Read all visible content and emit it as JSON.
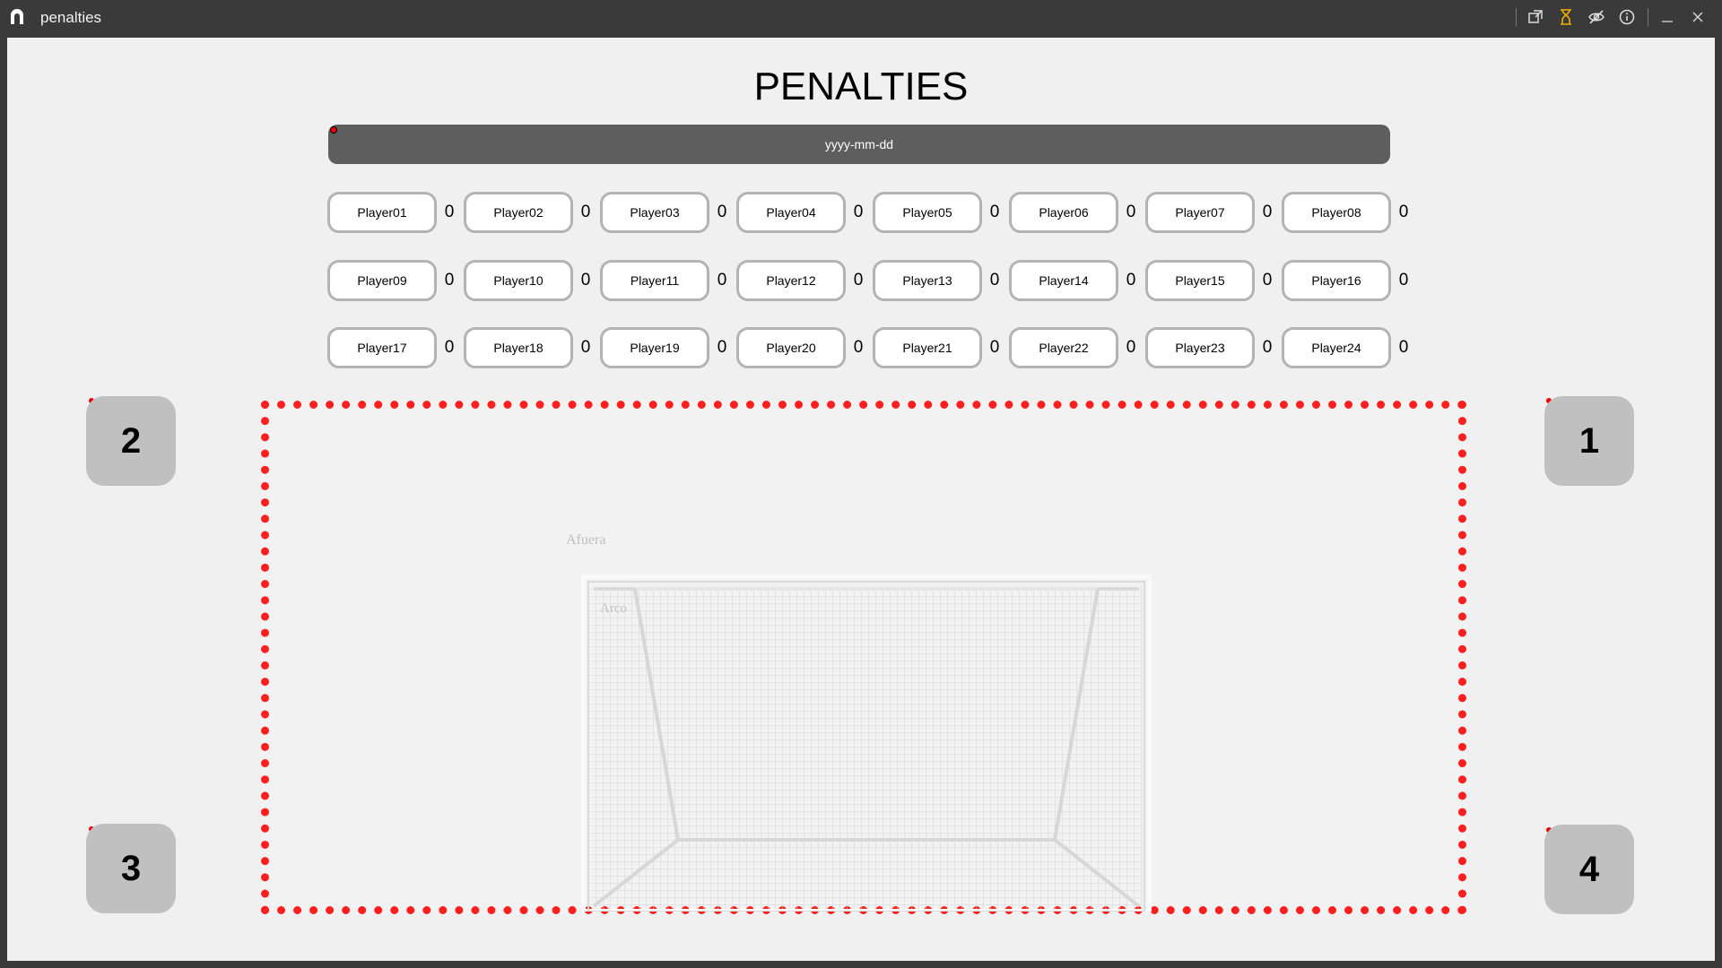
{
  "window": {
    "title": "penalties"
  },
  "page": {
    "title": "PENALTIES",
    "date_placeholder": "yyyy-mm-dd"
  },
  "players": [
    [
      {
        "name": "Player01",
        "score": "0"
      },
      {
        "name": "Player02",
        "score": "0"
      },
      {
        "name": "Player03",
        "score": "0"
      },
      {
        "name": "Player04",
        "score": "0"
      },
      {
        "name": "Player05",
        "score": "0"
      },
      {
        "name": "Player06",
        "score": "0"
      },
      {
        "name": "Player07",
        "score": "0"
      },
      {
        "name": "Player08",
        "score": "0"
      }
    ],
    [
      {
        "name": "Player09",
        "score": "0"
      },
      {
        "name": "Player10",
        "score": "0"
      },
      {
        "name": "Player11",
        "score": "0"
      },
      {
        "name": "Player12",
        "score": "0"
      },
      {
        "name": "Player13",
        "score": "0"
      },
      {
        "name": "Player14",
        "score": "0"
      },
      {
        "name": "Player15",
        "score": "0"
      },
      {
        "name": "Player16",
        "score": "0"
      }
    ],
    [
      {
        "name": "Player17",
        "score": "0"
      },
      {
        "name": "Player18",
        "score": "0"
      },
      {
        "name": "Player19",
        "score": "0"
      },
      {
        "name": "Player20",
        "score": "0"
      },
      {
        "name": "Player21",
        "score": "0"
      },
      {
        "name": "Player22",
        "score": "0"
      },
      {
        "name": "Player23",
        "score": "0"
      },
      {
        "name": "Player24",
        "score": "0"
      }
    ]
  ],
  "corners": {
    "top_left": "2",
    "top_right": "1",
    "bottom_left": "3",
    "bottom_right": "4"
  },
  "field": {
    "outside_label": "Afuera",
    "goal_label": "Arco"
  },
  "icons": {
    "app": "app-logo-icon",
    "popout": "popout-icon",
    "hourglass": "hourglass-icon",
    "eye_off": "eye-off-icon",
    "info": "info-icon",
    "minimize": "minimize-icon",
    "close": "close-icon"
  },
  "colors": {
    "target_border": "#ff1f1f",
    "date_bar": "#5e5e5e",
    "corner_button": "#c0c0c0",
    "hourglass": "#f0b000"
  }
}
